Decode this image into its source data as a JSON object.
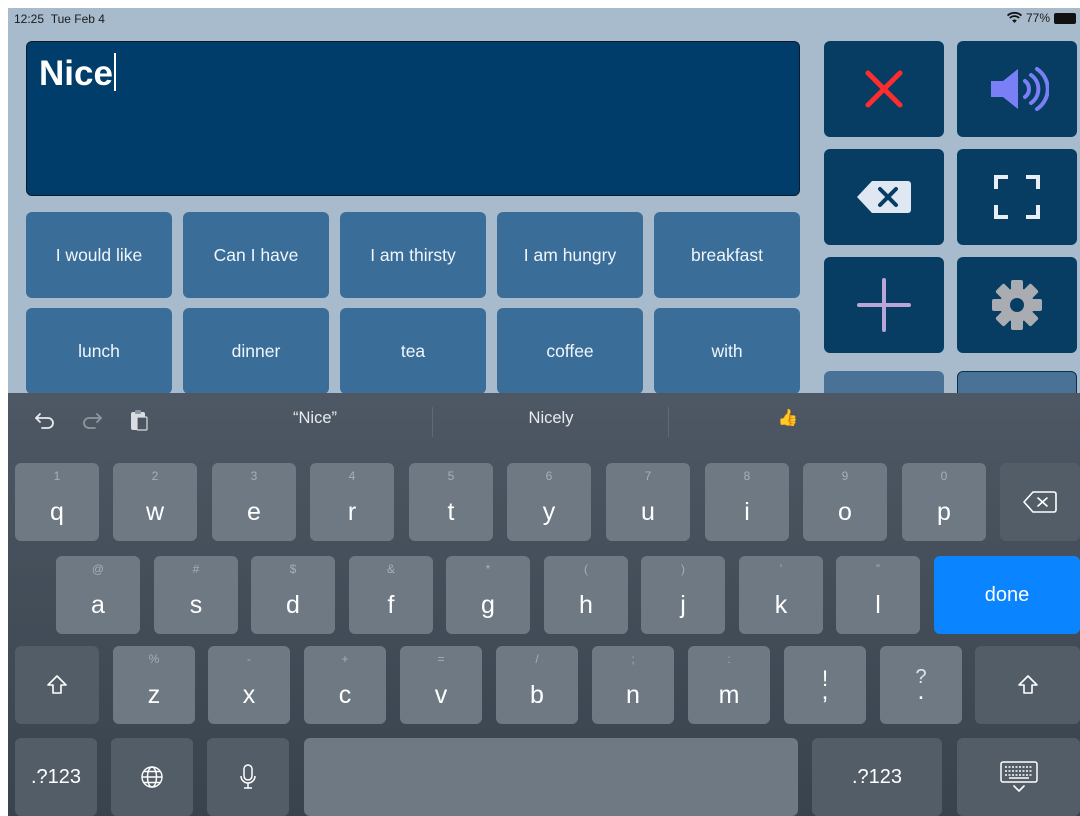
{
  "status_bar": {
    "time": "12:25",
    "date": "Tue Feb 4",
    "battery": "77%"
  },
  "text_display": {
    "value": "Nice"
  },
  "phrases": [
    "I would like",
    "Can I have",
    "I am thirsty",
    "I am hungry",
    "breakfast",
    "lunch",
    "dinner",
    "tea",
    "coffee",
    "with"
  ],
  "controls": {
    "clear_icon": "close-icon",
    "speak_icon": "speaker-icon",
    "backspace_icon": "backspace-icon",
    "fullscreen_icon": "fullscreen-icon",
    "add_icon": "plus-icon",
    "settings_icon": "gear-icon"
  },
  "colors": {
    "accent_red": "#ff2d2d",
    "accent_purple": "#7b7ff6",
    "done_blue": "#0a84ff"
  },
  "keyboard": {
    "suggestions": [
      "“Nice”",
      "Nicely",
      "👍"
    ],
    "row1": [
      {
        "hint": "1",
        "key": "q"
      },
      {
        "hint": "2",
        "key": "w"
      },
      {
        "hint": "3",
        "key": "e"
      },
      {
        "hint": "4",
        "key": "r"
      },
      {
        "hint": "5",
        "key": "t"
      },
      {
        "hint": "6",
        "key": "y"
      },
      {
        "hint": "7",
        "key": "u"
      },
      {
        "hint": "8",
        "key": "i"
      },
      {
        "hint": "9",
        "key": "o"
      },
      {
        "hint": "0",
        "key": "p"
      }
    ],
    "row2": [
      {
        "hint": "@",
        "key": "a"
      },
      {
        "hint": "#",
        "key": "s"
      },
      {
        "hint": "$",
        "key": "d"
      },
      {
        "hint": "&",
        "key": "f"
      },
      {
        "hint": "*",
        "key": "g"
      },
      {
        "hint": "(",
        "key": "h"
      },
      {
        "hint": ")",
        "key": "j"
      },
      {
        "hint": "’",
        "key": "k"
      },
      {
        "hint": "”",
        "key": "l"
      }
    ],
    "row3": [
      {
        "hint": "%",
        "key": "z"
      },
      {
        "hint": "-",
        "key": "x"
      },
      {
        "hint": "+",
        "key": "c"
      },
      {
        "hint": "=",
        "key": "v"
      },
      {
        "hint": "/",
        "key": "b"
      },
      {
        "hint": ";",
        "key": "n"
      },
      {
        "hint": ":",
        "key": "m"
      },
      {
        "hint": "!",
        "key": ","
      },
      {
        "hint": "?",
        "key": "."
      }
    ],
    "done_label": "done",
    "numbers_label": ".?123"
  }
}
